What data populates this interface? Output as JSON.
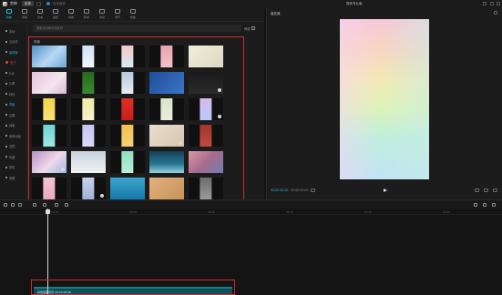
{
  "app": {
    "name": "剪映",
    "menu_label": "菜单",
    "autosave": "自动保存",
    "project_title": "剪映专业版"
  },
  "media_tabs": [
    {
      "label": "媒体",
      "icon": "media-icon"
    },
    {
      "label": "音频",
      "icon": "audio-icon"
    },
    {
      "label": "文本",
      "icon": "text-icon"
    },
    {
      "label": "贴纸",
      "icon": "sticker-icon"
    },
    {
      "label": "特效",
      "icon": "effects-icon"
    },
    {
      "label": "转场",
      "icon": "transition-icon"
    },
    {
      "label": "滤镜",
      "icon": "filter-icon"
    },
    {
      "label": "调节",
      "icon": "adjust-icon"
    },
    {
      "label": "模板",
      "icon": "template-icon"
    }
  ],
  "sidebar": [
    {
      "label": "本地",
      "state": "normal"
    },
    {
      "label": "云素材",
      "state": "normal"
    },
    {
      "label": "素材库",
      "state": "active"
    },
    {
      "label": "热门",
      "state": "hot"
    },
    {
      "label": "片头",
      "state": "normal"
    },
    {
      "label": "片尾",
      "state": "normal"
    },
    {
      "label": "转场",
      "state": "normal"
    },
    {
      "label": "背景",
      "state": "active"
    },
    {
      "label": "氛围",
      "state": "normal"
    },
    {
      "label": "绿幕",
      "state": "normal"
    },
    {
      "label": "故障动画",
      "state": "normal"
    },
    {
      "label": "空镜",
      "state": "normal"
    },
    {
      "label": "情绪",
      "state": "normal"
    },
    {
      "label": "搞笑",
      "state": "normal"
    },
    {
      "label": "收藏",
      "state": "normal"
    }
  ],
  "search": {
    "placeholder": "搜索素材库中的素材"
  },
  "filter_label": "筛选",
  "section_label": "背景",
  "thumbnails": [
    {
      "bg": "linear-gradient(135deg,#4e8fc8,#b7d8f2 55%,#6aa7d9)",
      "w": 100,
      "dl": false
    },
    {
      "bg": "linear-gradient(180deg,#cfe3f7,#f3f7fb)",
      "w": 35,
      "dl": false
    },
    {
      "bg": "linear-gradient(180deg,#f2c9c9,#d7e8f4)",
      "w": 35,
      "dl": false
    },
    {
      "bg": "linear-gradient(180deg,#e9a2b2,#f3c0cb)",
      "w": 35,
      "dl": false
    },
    {
      "bg": "linear-gradient(135deg,#efeedd,#dcd8c3)",
      "w": 100,
      "dl": true
    },
    {
      "bg": "linear-gradient(135deg,#e6c2d9,#f3e6ef 60%,#d7b5cd)",
      "w": 100,
      "dl": true
    },
    {
      "bg": "linear-gradient(180deg,#25691f,#3a8a2e)",
      "w": 35,
      "dl": false
    },
    {
      "bg": "linear-gradient(180deg,#b5c9df,#e8eef5)",
      "w": 35,
      "dl": false
    },
    {
      "bg": "linear-gradient(135deg,#1f4d97,#3d75c9)",
      "w": 100,
      "dl": false
    },
    {
      "bg": "linear-gradient(180deg,#1a1a1a,#2b2b2b)",
      "w": 100,
      "dl": true
    },
    {
      "bg": "linear-gradient(180deg,#f4d649,#f7e27a)",
      "w": 35,
      "dl": false
    },
    {
      "bg": "linear-gradient(180deg,#f0eaa7,#f7f3cb)",
      "w": 35,
      "dl": false
    },
    {
      "bg": "linear-gradient(180deg,#e12f25,#c82018)",
      "w": 35,
      "dl": false
    },
    {
      "bg": "linear-gradient(180deg,#dbe2c8,#eaeedc)",
      "w": 35,
      "dl": false
    },
    {
      "bg": "linear-gradient(180deg,#d7b9ee,#b9c9f7)",
      "w": 35,
      "dl": true
    },
    {
      "bg": "linear-gradient(180deg,#6cd6d3,#9fe8e2)",
      "w": 35,
      "dl": false
    },
    {
      "bg": "linear-gradient(180deg,#c9c3f2,#dcd9f8)",
      "w": 35,
      "dl": false
    },
    {
      "bg": "linear-gradient(180deg,#f3c04e,#f6d079)",
      "w": 35,
      "dl": false
    },
    {
      "bg": "linear-gradient(135deg,#e9dfcf,#d5c6ae)",
      "w": 100,
      "dl": true
    },
    {
      "bg": "linear-gradient(180deg,#a0352c,#c24a3e)",
      "w": 35,
      "dl": false
    },
    {
      "bg": "linear-gradient(135deg,#b58fc4,#f0d9ec 55%,#9cb6df)",
      "w": 100,
      "dl": true
    },
    {
      "bg": "linear-gradient(180deg,#c9d3dc,#f1f3f5)",
      "w": 100,
      "dl": false
    },
    {
      "bg": "linear-gradient(180deg,#8fe0c2,#b8efd8)",
      "w": 35,
      "dl": false
    },
    {
      "bg": "linear-gradient(180deg,#133f55,#2b7a96 60%,#9ad0dd)",
      "w": 100,
      "dl": false
    },
    {
      "bg": "linear-gradient(135deg,#d89aa8,#a86a8d 50%,#6d7fb2)",
      "w": 100,
      "dl": false
    },
    {
      "bg": "linear-gradient(180deg,#f6c4d2,#e9a9c0)",
      "w": 35,
      "dl": false
    },
    {
      "bg": "linear-gradient(180deg,#c9d4ea,#9fb1d8)",
      "w": 35,
      "dl": true
    },
    {
      "bg": "linear-gradient(180deg,#3fa3cf,#157aa8)",
      "w": 100,
      "dl": false
    },
    {
      "bg": "linear-gradient(135deg,#e2b17c,#c8925c)",
      "w": 100,
      "dl": false
    },
    {
      "bg": "linear-gradient(180deg,#6c6c6c,#9a9a9a)",
      "w": 35,
      "dl": false
    }
  ],
  "player": {
    "title": "播放器",
    "time_current": "00:00:00:00",
    "time_total": "00:00:05:00"
  },
  "timeline": {
    "ticks": [
      "00:00",
      "00:05",
      "00:10",
      "00:15",
      "00:20",
      "00:25"
    ],
    "clip_label": "彩色渐变背景  00:00:05:00"
  }
}
